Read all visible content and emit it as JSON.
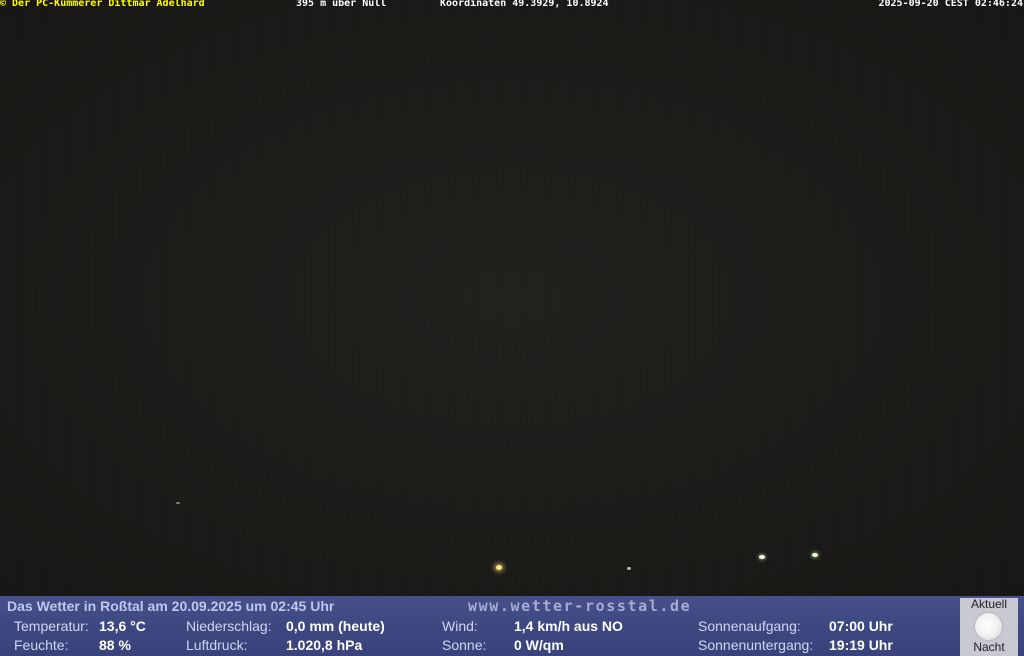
{
  "overlay": {
    "credit": "© Der PC-Kümmerer Dittmar Adelhard",
    "altitude": "395 m über Null",
    "coordinates": "Koordinaten 49.3929, 10.8924",
    "datetime": "2025-09-20 CEST 02:46:24"
  },
  "weather": {
    "title": "Das Wetter in Roßtal am 20.09.2025 um 02:45 Uhr",
    "website": "www.wetter-rosstal.de",
    "temperature": {
      "label": "Temperatur:",
      "value": "13,6 °C"
    },
    "humidity": {
      "label": "Feuchte:",
      "value": "88 %"
    },
    "precipitation": {
      "label": "Niederschlag:",
      "value": "0,0 mm (heute)"
    },
    "pressure": {
      "label": "Luftdruck:",
      "value": "1.020,8 hPa"
    },
    "wind": {
      "label": "Wind:",
      "value": "1,4 km/h aus NO"
    },
    "sun": {
      "label": "Sonne:",
      "value": "0 W/qm"
    },
    "sunrise": {
      "label": "Sonnenaufgang:",
      "value": "07:00 Uhr"
    },
    "sunset": {
      "label": "Sonnenuntergang:",
      "value": "19:19 Uhr"
    }
  },
  "moon": {
    "top_label": "Aktuell",
    "bottom_label": "Nacht",
    "icon": "full-moon-icon"
  },
  "colors": {
    "credit_text": "#ffff00",
    "panel_background": "#3e4880",
    "title_text": "#bcc8f0"
  }
}
